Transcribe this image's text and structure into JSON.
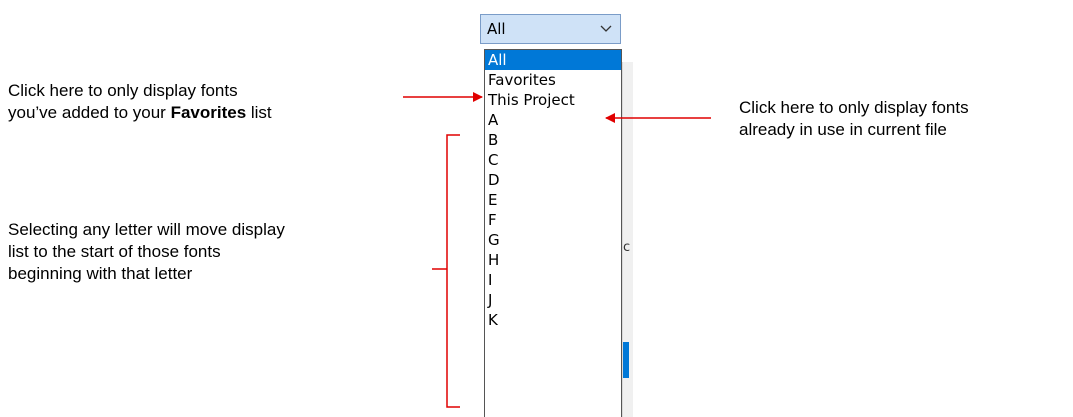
{
  "combo": {
    "value": "All",
    "chevron_icon": "chevron-down-icon"
  },
  "dropdown": {
    "options": [
      "All",
      "Favorites",
      "This Project",
      "A",
      "B",
      "C",
      "D",
      "E",
      "F",
      "G",
      "H",
      "I",
      "J",
      "K"
    ],
    "selected_index": 0
  },
  "background_ui": {
    "partial_char": "c"
  },
  "annotations": {
    "favorites": {
      "line1": "Click here to only display fonts",
      "line2_before": "you’ve added to your ",
      "line2_bold": "Favorites",
      "line2_after": " list"
    },
    "this_project": {
      "line1": "Click here to only display fonts",
      "line2": "already in use in current file"
    },
    "letters": {
      "line1": "Selecting any letter will move display",
      "line2": "list to the start of those fonts",
      "line3": "beginning with that letter"
    }
  },
  "colors": {
    "arrow": "#e00000",
    "selection": "#0078d7",
    "combo_bg": "#cfe2f7"
  }
}
